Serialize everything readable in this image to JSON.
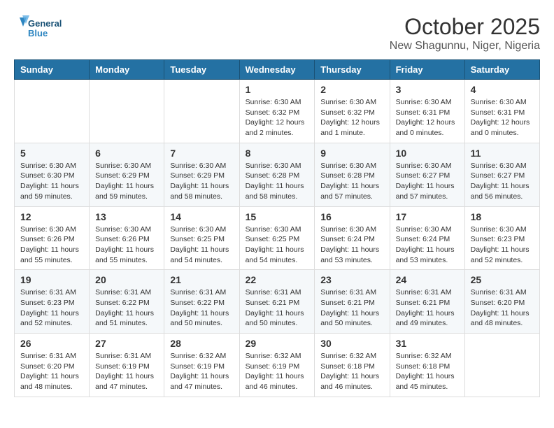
{
  "header": {
    "logo_line1": "General",
    "logo_line2": "Blue",
    "month": "October 2025",
    "location": "New Shagunnu, Niger, Nigeria"
  },
  "weekdays": [
    "Sunday",
    "Monday",
    "Tuesday",
    "Wednesday",
    "Thursday",
    "Friday",
    "Saturday"
  ],
  "weeks": [
    [
      {
        "day": "",
        "info": ""
      },
      {
        "day": "",
        "info": ""
      },
      {
        "day": "",
        "info": ""
      },
      {
        "day": "1",
        "info": "Sunrise: 6:30 AM\nSunset: 6:32 PM\nDaylight: 12 hours\nand 2 minutes."
      },
      {
        "day": "2",
        "info": "Sunrise: 6:30 AM\nSunset: 6:32 PM\nDaylight: 12 hours\nand 1 minute."
      },
      {
        "day": "3",
        "info": "Sunrise: 6:30 AM\nSunset: 6:31 PM\nDaylight: 12 hours\nand 0 minutes."
      },
      {
        "day": "4",
        "info": "Sunrise: 6:30 AM\nSunset: 6:31 PM\nDaylight: 12 hours\nand 0 minutes."
      }
    ],
    [
      {
        "day": "5",
        "info": "Sunrise: 6:30 AM\nSunset: 6:30 PM\nDaylight: 11 hours\nand 59 minutes."
      },
      {
        "day": "6",
        "info": "Sunrise: 6:30 AM\nSunset: 6:29 PM\nDaylight: 11 hours\nand 59 minutes."
      },
      {
        "day": "7",
        "info": "Sunrise: 6:30 AM\nSunset: 6:29 PM\nDaylight: 11 hours\nand 58 minutes."
      },
      {
        "day": "8",
        "info": "Sunrise: 6:30 AM\nSunset: 6:28 PM\nDaylight: 11 hours\nand 58 minutes."
      },
      {
        "day": "9",
        "info": "Sunrise: 6:30 AM\nSunset: 6:28 PM\nDaylight: 11 hours\nand 57 minutes."
      },
      {
        "day": "10",
        "info": "Sunrise: 6:30 AM\nSunset: 6:27 PM\nDaylight: 11 hours\nand 57 minutes."
      },
      {
        "day": "11",
        "info": "Sunrise: 6:30 AM\nSunset: 6:27 PM\nDaylight: 11 hours\nand 56 minutes."
      }
    ],
    [
      {
        "day": "12",
        "info": "Sunrise: 6:30 AM\nSunset: 6:26 PM\nDaylight: 11 hours\nand 55 minutes."
      },
      {
        "day": "13",
        "info": "Sunrise: 6:30 AM\nSunset: 6:26 PM\nDaylight: 11 hours\nand 55 minutes."
      },
      {
        "day": "14",
        "info": "Sunrise: 6:30 AM\nSunset: 6:25 PM\nDaylight: 11 hours\nand 54 minutes."
      },
      {
        "day": "15",
        "info": "Sunrise: 6:30 AM\nSunset: 6:25 PM\nDaylight: 11 hours\nand 54 minutes."
      },
      {
        "day": "16",
        "info": "Sunrise: 6:30 AM\nSunset: 6:24 PM\nDaylight: 11 hours\nand 53 minutes."
      },
      {
        "day": "17",
        "info": "Sunrise: 6:30 AM\nSunset: 6:24 PM\nDaylight: 11 hours\nand 53 minutes."
      },
      {
        "day": "18",
        "info": "Sunrise: 6:30 AM\nSunset: 6:23 PM\nDaylight: 11 hours\nand 52 minutes."
      }
    ],
    [
      {
        "day": "19",
        "info": "Sunrise: 6:31 AM\nSunset: 6:23 PM\nDaylight: 11 hours\nand 52 minutes."
      },
      {
        "day": "20",
        "info": "Sunrise: 6:31 AM\nSunset: 6:22 PM\nDaylight: 11 hours\nand 51 minutes."
      },
      {
        "day": "21",
        "info": "Sunrise: 6:31 AM\nSunset: 6:22 PM\nDaylight: 11 hours\nand 50 minutes."
      },
      {
        "day": "22",
        "info": "Sunrise: 6:31 AM\nSunset: 6:21 PM\nDaylight: 11 hours\nand 50 minutes."
      },
      {
        "day": "23",
        "info": "Sunrise: 6:31 AM\nSunset: 6:21 PM\nDaylight: 11 hours\nand 50 minutes."
      },
      {
        "day": "24",
        "info": "Sunrise: 6:31 AM\nSunset: 6:21 PM\nDaylight: 11 hours\nand 49 minutes."
      },
      {
        "day": "25",
        "info": "Sunrise: 6:31 AM\nSunset: 6:20 PM\nDaylight: 11 hours\nand 48 minutes."
      }
    ],
    [
      {
        "day": "26",
        "info": "Sunrise: 6:31 AM\nSunset: 6:20 PM\nDaylight: 11 hours\nand 48 minutes."
      },
      {
        "day": "27",
        "info": "Sunrise: 6:31 AM\nSunset: 6:19 PM\nDaylight: 11 hours\nand 47 minutes."
      },
      {
        "day": "28",
        "info": "Sunrise: 6:32 AM\nSunset: 6:19 PM\nDaylight: 11 hours\nand 47 minutes."
      },
      {
        "day": "29",
        "info": "Sunrise: 6:32 AM\nSunset: 6:19 PM\nDaylight: 11 hours\nand 46 minutes."
      },
      {
        "day": "30",
        "info": "Sunrise: 6:32 AM\nSunset: 6:18 PM\nDaylight: 11 hours\nand 46 minutes."
      },
      {
        "day": "31",
        "info": "Sunrise: 6:32 AM\nSunset: 6:18 PM\nDaylight: 11 hours\nand 45 minutes."
      },
      {
        "day": "",
        "info": ""
      }
    ]
  ]
}
